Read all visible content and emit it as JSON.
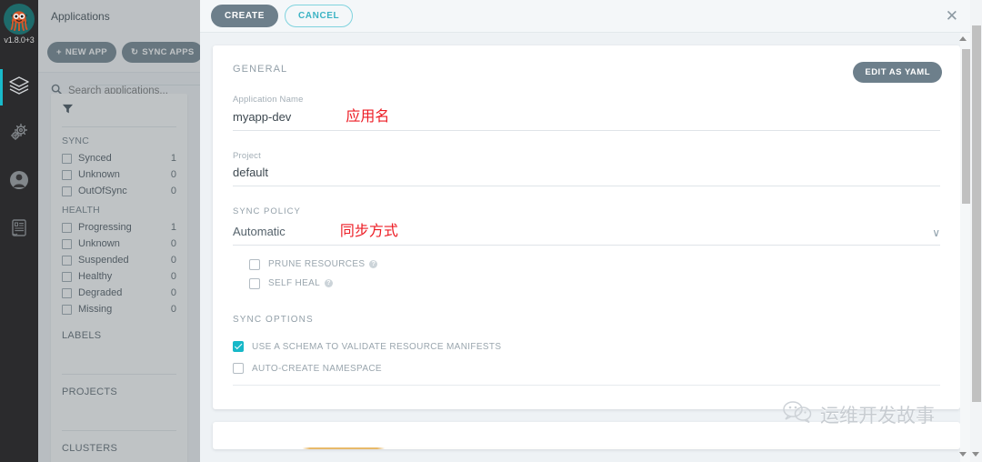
{
  "rail": {
    "version": "v1.8.0+3",
    "items": [
      {
        "icon": "layers-icon",
        "name": "nav-applications",
        "active": true
      },
      {
        "icon": "gears-icon",
        "name": "nav-settings",
        "active": false
      },
      {
        "icon": "user-icon",
        "name": "nav-user-info",
        "active": false
      },
      {
        "icon": "book-icon",
        "name": "nav-documentation",
        "active": false
      }
    ]
  },
  "sidebar": {
    "title": "Applications",
    "new_app_label": "NEW APP",
    "sync_apps_label": "SYNC APPS",
    "search_placeholder": "Search applications...",
    "search_value": "",
    "filter_groups": [
      {
        "title": "SYNC",
        "rows": [
          {
            "label": "Synced",
            "count": "1",
            "checked": false
          },
          {
            "label": "Unknown",
            "count": "0",
            "checked": false
          },
          {
            "label": "OutOfSync",
            "count": "0",
            "checked": false
          }
        ]
      },
      {
        "title": "HEALTH",
        "rows": [
          {
            "label": "Progressing",
            "count": "1",
            "checked": false
          },
          {
            "label": "Unknown",
            "count": "0",
            "checked": false
          },
          {
            "label": "Suspended",
            "count": "0",
            "checked": false
          },
          {
            "label": "Healthy",
            "count": "0",
            "checked": false
          },
          {
            "label": "Degraded",
            "count": "0",
            "checked": false
          },
          {
            "label": "Missing",
            "count": "0",
            "checked": false
          }
        ]
      }
    ],
    "sections": [
      "LABELS",
      "PROJECTS",
      "CLUSTERS"
    ]
  },
  "toolbar": {
    "create_label": "CREATE",
    "cancel_label": "CANCEL",
    "close_icon": "✕"
  },
  "form": {
    "edit_yaml_label": "EDIT AS YAML",
    "general_label": "GENERAL",
    "app_name_label": "Application Name",
    "app_name_value": "myapp-dev",
    "app_name_annotation": "应用名",
    "project_label": "Project",
    "project_value": "default",
    "sync_policy_label": "SYNC POLICY",
    "sync_policy_value": "Automatic",
    "sync_policy_annotation": "同步方式",
    "sync_policy_chevron": "∨",
    "prune_label": "PRUNE RESOURCES",
    "self_heal_label": "SELF HEAL",
    "prune_checked": false,
    "self_heal_checked": false,
    "sync_options_label": "SYNC OPTIONS",
    "schema_label": "USE A SCHEMA TO VALIDATE RESOURCE MANIFESTS",
    "schema_checked": true,
    "auto_ns_label": "AUTO-CREATE NAMESPACE",
    "auto_ns_checked": false,
    "help_glyph": "?"
  },
  "watermark": {
    "text": "运维开发故事"
  },
  "colors": {
    "accent_teal": "#17b8c8",
    "slate": "#6d7f8b",
    "annotation_red": "#ed1c24",
    "rail_dark": "#2b2b2d"
  }
}
